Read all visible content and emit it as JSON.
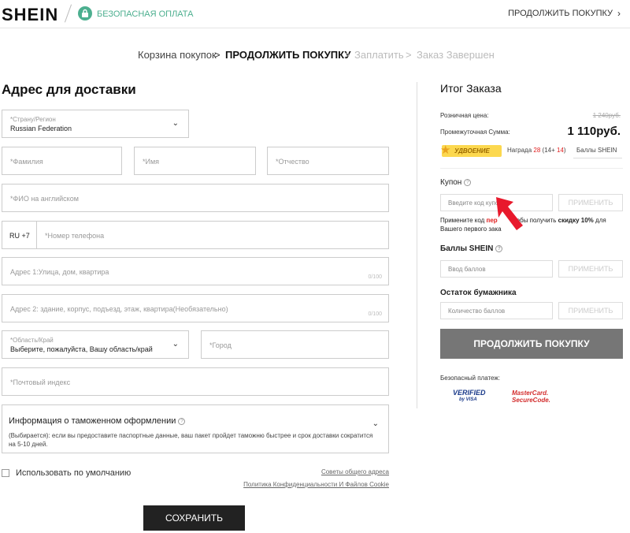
{
  "header": {
    "logo": "SHEIN",
    "secure_text": "БЕЗОПАСНАЯ ОПЛАТА",
    "continue_link": "ПРОДОЛЖИТЬ ПОКУПКУ",
    "chevron": "›",
    "accent_color": "#4caf8f"
  },
  "breadcrumb": {
    "step1": "Корзина покупок",
    "sep": ">",
    "step2": "ПРОДОЛЖИТЬ ПОКУПКУ",
    "step3": "Заплатить",
    "step4": "Заказ Завершен"
  },
  "address": {
    "title": "Адрес для доставки",
    "country_label": "*Страну/Регион",
    "country_value": "Russian Federation",
    "lastname": "*Фамилия",
    "firstname": "*Имя",
    "patronymic": "*Отчество",
    "fullname_en": "*ФИО на английском",
    "phone_code": "RU +7",
    "phone": "*Номер телефона",
    "address1": "Адрес 1:Улица, дом, квартира",
    "address1_counter": "0/100",
    "address2": "Адрес 2: здание, корпус, подъезд, этаж, квартира(Необязательно)",
    "address2_counter": "0/100",
    "region_label": "*Область/Край",
    "region_value": "Выберите, пожалуйста, Вашу область/край",
    "city": "*Город",
    "postcode": "*Почтовый индекс",
    "customs_title": "Информация о таможенном оформлении",
    "customs_desc": "(Выбирается): если вы предоставите паспортные данные, ваш пакет пройдет таможню быстрее и срок доставки сократится на 5-10 дней.",
    "use_default": "Использовать по умолчанию",
    "tips_link": "Советы общего адреса",
    "privacy_link": "Политика Конфиденциальности И Файлов Cookie",
    "save": "СОХРАНИТЬ"
  },
  "summary": {
    "title": "Итог Заказа",
    "retail_label": "Розничная цена:",
    "retail_value": "1 240руб.",
    "subtotal_label": "Промежуточная Сумма:",
    "subtotal_value": "1 110руб.",
    "promo_badge": "УДВОЕНИЕ",
    "reward_prefix": "Награда",
    "reward_total": "28",
    "reward_open": "(14+",
    "reward_bonus": "14",
    "reward_close": ")",
    "reward_points_label": "Баллы SHEIN",
    "coupon_title": "Купон",
    "coupon_placeholder": "Введите код купона",
    "apply": "ПРИМЕНИТЬ",
    "coupon_note_start": "Примените код",
    "coupon_note_code": "пер",
    "coupon_note_mid": "чтобы получить",
    "coupon_note_bold": "скидку 10%",
    "coupon_note_end": "для Вашего первого зака",
    "points_title": "Баллы SHEIN",
    "points_placeholder": "Ввод баллов",
    "wallet_title": "Остаток бумажника",
    "wallet_placeholder": "Количество баллов",
    "continue_button": "ПРОДОЛЖИТЬ ПОКУПКУ",
    "secure_pay_label": "Безопасный платеж:",
    "visa_top": "VERIFIED",
    "visa_bottom": "by VISA",
    "mc_top": "MasterCard.",
    "mc_bottom": "SecureCode."
  }
}
